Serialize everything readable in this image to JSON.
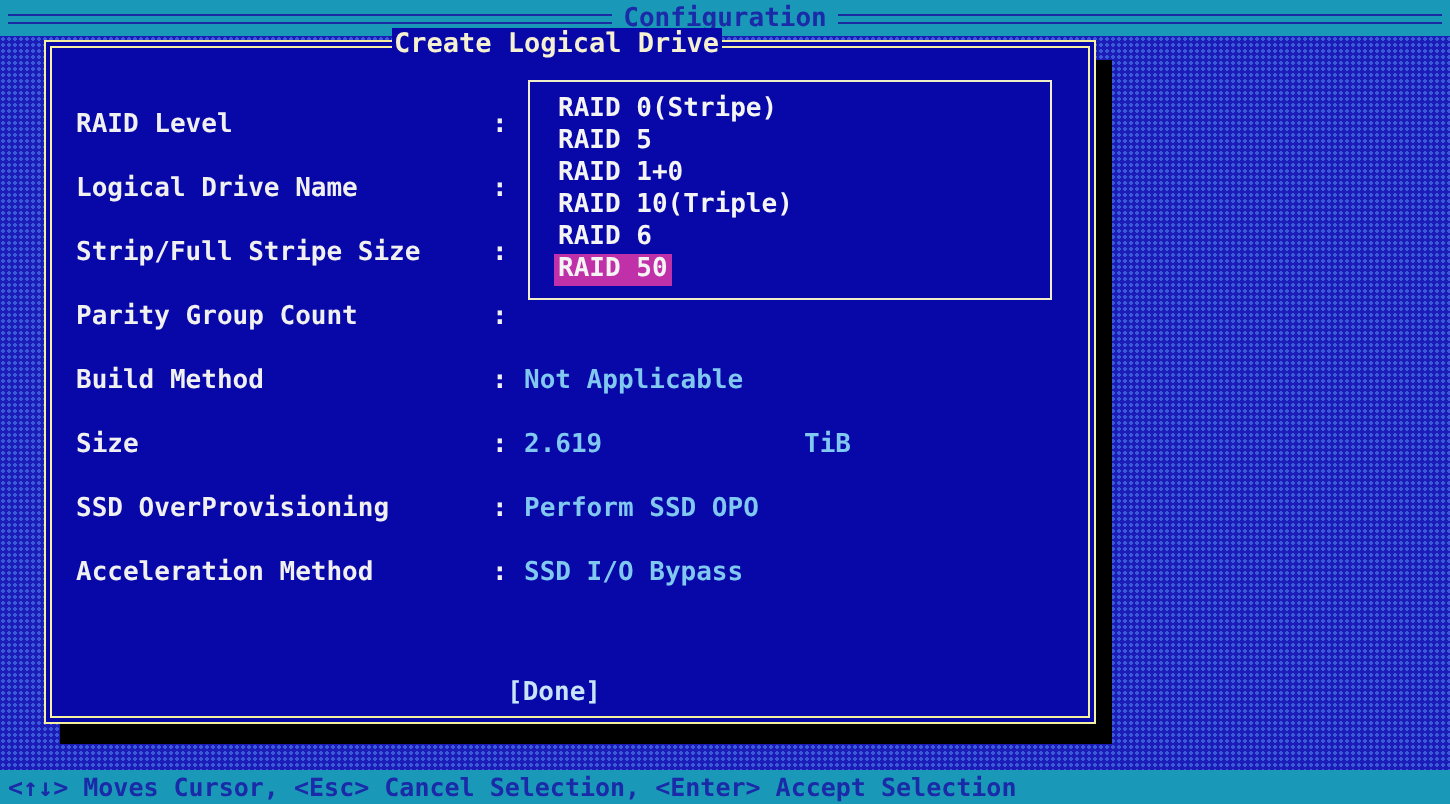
{
  "header": {
    "title": "Configuration"
  },
  "dialog": {
    "title": "Create Logical Drive",
    "fields": [
      {
        "label": "RAID Level",
        "separator": ":"
      },
      {
        "label": "Logical Drive Name",
        "separator": ":"
      },
      {
        "label": "Strip/Full Stripe Size",
        "separator": ":"
      },
      {
        "label": "Parity Group Count",
        "separator": ":"
      },
      {
        "label": "Build Method",
        "separator": ":",
        "value": "Not Applicable"
      },
      {
        "label": "Size",
        "separator": ":",
        "value": "2.619",
        "unit": "TiB"
      },
      {
        "label": "SSD OverProvisioning",
        "separator": ":",
        "value": "Perform SSD OPO"
      },
      {
        "label": "Acceleration Method",
        "separator": ":",
        "value": "SSD I/O Bypass"
      }
    ],
    "button": "[Done]"
  },
  "popup": {
    "options": [
      {
        "label": "RAID 0(Stripe)",
        "selected": false
      },
      {
        "label": "RAID 5",
        "selected": false
      },
      {
        "label": "RAID 1+0",
        "selected": false
      },
      {
        "label": "RAID 10(Triple)",
        "selected": false
      },
      {
        "label": "RAID 6",
        "selected": false
      },
      {
        "label": "RAID 50",
        "selected": true
      }
    ]
  },
  "footer": {
    "hint": "<↑↓> Moves Cursor, <Esc> Cancel Selection, <Enter> Accept Selection"
  }
}
